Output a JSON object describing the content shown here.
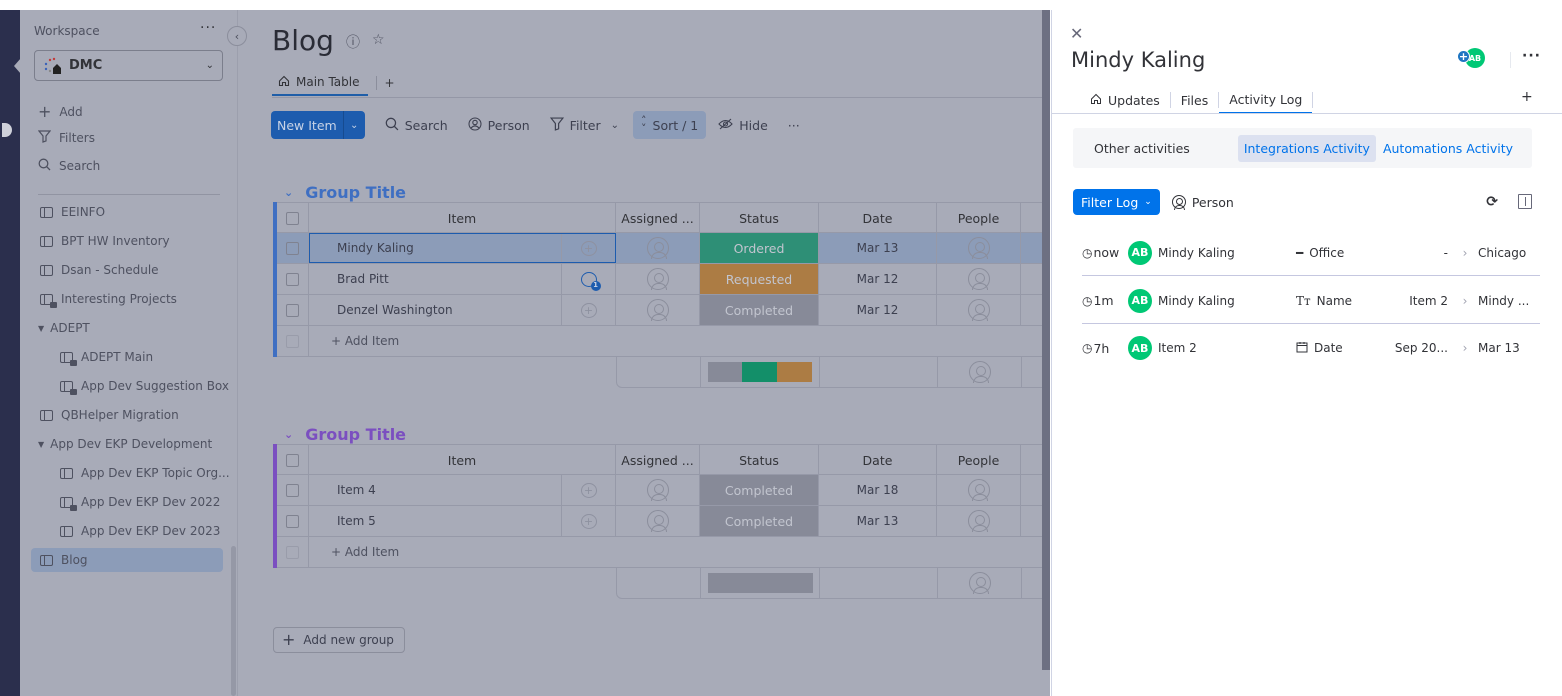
{
  "sidebar": {
    "workspace_label": "Workspace",
    "workspace_name": "DMC",
    "actions": [
      {
        "icon": "plus-icon",
        "label": "Add"
      },
      {
        "icon": "filter-icon",
        "label": "Filters"
      },
      {
        "icon": "search-icon",
        "label": "Search"
      }
    ],
    "items": [
      {
        "label": "EEINFO",
        "type": "board"
      },
      {
        "label": "BPT HW Inventory",
        "type": "board"
      },
      {
        "label": "Dsan - Schedule",
        "type": "board"
      },
      {
        "label": "Interesting Projects",
        "type": "private-board"
      },
      {
        "label": "ADEPT",
        "type": "folder"
      },
      {
        "label": "ADEPT Main",
        "type": "private-board",
        "child": true
      },
      {
        "label": "App Dev Suggestion Box",
        "type": "private-board",
        "child": true
      },
      {
        "label": "QBHelper Migration",
        "type": "board"
      },
      {
        "label": "App Dev EKP Development",
        "type": "folder"
      },
      {
        "label": "App Dev EKP Topic Org...",
        "type": "board",
        "child": true
      },
      {
        "label": "App Dev EKP Dev 2022",
        "type": "private-board",
        "child": true
      },
      {
        "label": "App Dev EKP Dev 2023",
        "type": "board",
        "child": true
      },
      {
        "label": "Blog",
        "type": "board",
        "active": true
      }
    ]
  },
  "board": {
    "title": "Blog",
    "view_tab": "Main Table",
    "add_view": "+",
    "toolbar": {
      "new_item": "New Item",
      "search": "Search",
      "person": "Person",
      "filter": "Filter",
      "sort": "Sort / 1",
      "hide": "Hide",
      "more": "···"
    },
    "columns": [
      "Item",
      "Assigned ...",
      "Status",
      "Date",
      "People"
    ],
    "add_item": "+ Add Item",
    "add_group": "Add new group",
    "groups": [
      {
        "title": "Group Title",
        "color": "#3f6fc2",
        "rows": [
          {
            "name": "Mindy Kaling",
            "status": "Ordered",
            "status_color": "#2e8f76",
            "date": "Mar 13",
            "selected": true,
            "updates": 0
          },
          {
            "name": "Brad Pitt",
            "status": "Requested",
            "status_color": "#ac7c44",
            "date": "Mar 12",
            "updates": 1
          },
          {
            "name": "Denzel Washington",
            "status": "Completed",
            "status_color": "#878a98",
            "date": "Mar 12",
            "updates": 0
          }
        ],
        "summary": [
          {
            "color": "#878a98",
            "fraction": 0.333
          },
          {
            "color": "#138f69",
            "fraction": 0.333
          },
          {
            "color": "#ac7c44",
            "fraction": 0.334
          }
        ]
      },
      {
        "title": "Group Title",
        "color": "#7b4fc0",
        "rows": [
          {
            "name": "Item 4",
            "status": "Completed",
            "status_color": "#878a98",
            "date": "Mar 18",
            "updates": 0
          },
          {
            "name": "Item 5",
            "status": "Completed",
            "status_color": "#878a98",
            "date": "Mar 13",
            "updates": 0
          }
        ],
        "summary": [
          {
            "color": "#878a98",
            "fraction": 1.0
          }
        ]
      }
    ]
  },
  "panel": {
    "title": "Mindy Kaling",
    "avatar_initials": "AB",
    "tabs": [
      "Updates",
      "Files",
      "Activity Log"
    ],
    "active_tab": "Activity Log",
    "subnav": {
      "other": "Other activities",
      "integrations": "Integrations Activity",
      "automations": "Automations Activity"
    },
    "filter_log": "Filter Log",
    "person": "Person",
    "log": [
      {
        "time": "now",
        "initials": "AB",
        "name": "Mindy Kaling",
        "col_icon": "dash-icon",
        "column": "Office",
        "from": "-",
        "to": "Chicago"
      },
      {
        "time": "1m",
        "initials": "AB",
        "name": "Mindy Kaling",
        "col_icon": "text-icon",
        "column": "Name",
        "from": "Item 2",
        "to": "Mindy ..."
      },
      {
        "time": "7h",
        "initials": "AB",
        "name": "Item 2",
        "col_icon": "calendar-icon",
        "column": "Date",
        "from": "Sep 20...",
        "to": "Mar 13"
      }
    ]
  }
}
